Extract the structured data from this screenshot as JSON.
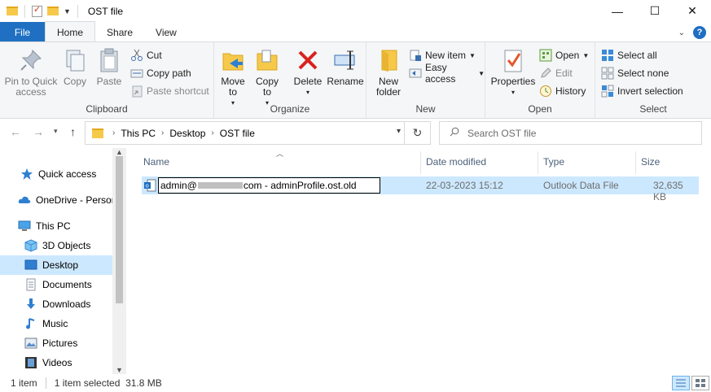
{
  "window": {
    "title": "OST file",
    "minimize_glyph": "—",
    "maximize_glyph": "☐",
    "close_glyph": "✕"
  },
  "ribbon_tabs": {
    "file": "File",
    "home": "Home",
    "share": "Share",
    "view": "View"
  },
  "ribbon": {
    "clipboard": {
      "label": "Clipboard",
      "pin": "Pin to Quick access",
      "copy": "Copy",
      "paste": "Paste",
      "cut": "Cut",
      "copy_path": "Copy path",
      "paste_shortcut": "Paste shortcut"
    },
    "organize": {
      "label": "Organize",
      "move_to": "Move to",
      "copy_to": "Copy to",
      "delete": "Delete",
      "rename": "Rename"
    },
    "new": {
      "label": "New",
      "new_folder": "New folder",
      "new_item": "New item",
      "easy_access": "Easy access"
    },
    "open": {
      "label": "Open",
      "properties": "Properties",
      "open": "Open",
      "edit": "Edit",
      "history": "History"
    },
    "select": {
      "label": "Select",
      "select_all": "Select all",
      "select_none": "Select none",
      "invert_selection": "Invert selection"
    }
  },
  "address": {
    "crumbs": [
      "This PC",
      "Desktop",
      "OST file"
    ],
    "search_placeholder": "Search OST file"
  },
  "nav_pane": {
    "items": [
      {
        "label": "Quick access",
        "icon": "star-icon"
      },
      {
        "label": "OneDrive - Person",
        "icon": "cloud-icon"
      },
      {
        "label": "This PC",
        "icon": "computer-icon"
      },
      {
        "label": "3D Objects",
        "icon": "cube-icon"
      },
      {
        "label": "Desktop",
        "icon": "desktop-icon"
      },
      {
        "label": "Documents",
        "icon": "document-icon"
      },
      {
        "label": "Downloads",
        "icon": "download-arrow-icon"
      },
      {
        "label": "Music",
        "icon": "music-note-icon"
      },
      {
        "label": "Pictures",
        "icon": "picture-icon"
      },
      {
        "label": "Videos",
        "icon": "film-icon"
      }
    ]
  },
  "file_list": {
    "columns": {
      "name": "Name",
      "date_modified": "Date modified",
      "type": "Type",
      "size": "Size"
    },
    "rows": [
      {
        "name_prefix": "admin@",
        "name_suffix": "com - adminProfile.ost.old",
        "date_modified": "22-03-2023 15:12",
        "type": "Outlook Data File",
        "size": "32,635 KB"
      }
    ]
  },
  "status_bar": {
    "item_count": "1 item",
    "selection": "1 item selected  31.8 MB"
  },
  "colors": {
    "accent": "#1f6fc2",
    "selection": "#cce8ff",
    "folder": "#f6c94a",
    "delete_red": "#d8231f"
  }
}
